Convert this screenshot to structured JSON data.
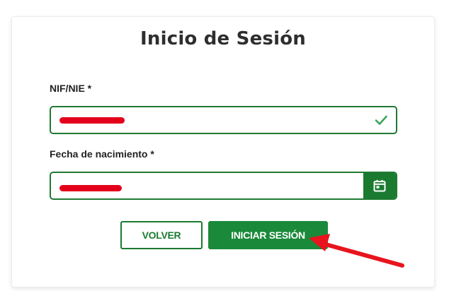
{
  "form": {
    "title": "Inicio de Sesión",
    "nif_label": "NIF/NIE *",
    "nif_value": "",
    "dob_label": "Fecha de nacimiento *",
    "dob_value": ""
  },
  "actions": {
    "back_label": "VOLVER",
    "login_label": "INICIAR SESIÓN"
  },
  "icons": {
    "valid": "check-icon",
    "calendar": "calendar-icon"
  },
  "colors": {
    "brand_green": "#1a7a30",
    "button_green": "#1a8a3a",
    "check_green": "#3aa55a",
    "redaction_red": "#e3001b",
    "arrow_red": "#e8141e"
  }
}
